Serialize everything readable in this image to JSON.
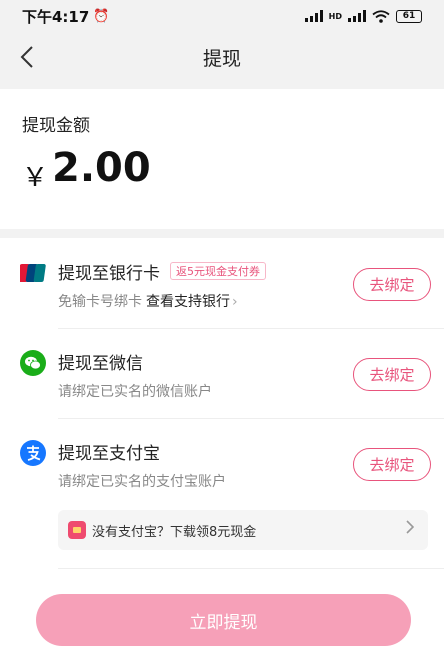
{
  "status_bar": {
    "time": "下午4:17",
    "network_label": "HD",
    "battery": "61"
  },
  "nav": {
    "title": "提现"
  },
  "amount": {
    "label": "提现金额",
    "currency": "￥",
    "value": "2.00"
  },
  "methods": [
    {
      "name": "提现至银行卡",
      "icon": "unionpay-icon",
      "badge": "返5元现金支付券",
      "desc": "免输卡号绑卡",
      "link": "查看支持银行",
      "button": "去绑定"
    },
    {
      "name": "提现至微信",
      "icon": "wechat-icon",
      "desc": "请绑定已实名的微信账户",
      "button": "去绑定"
    },
    {
      "name": "提现至支付宝",
      "icon": "alipay-icon",
      "desc": "请绑定已实名的支付宝账户",
      "button": "去绑定"
    }
  ],
  "promo": {
    "text": "没有支付宝？下载领8元现金",
    "icon": "red-envelope-icon"
  },
  "submit": {
    "label": "立即提现"
  },
  "colors": {
    "accent": "#e8547c",
    "button_disabled": "#f6a0b8",
    "wechat": "#1aad19",
    "alipay": "#1677ff"
  }
}
